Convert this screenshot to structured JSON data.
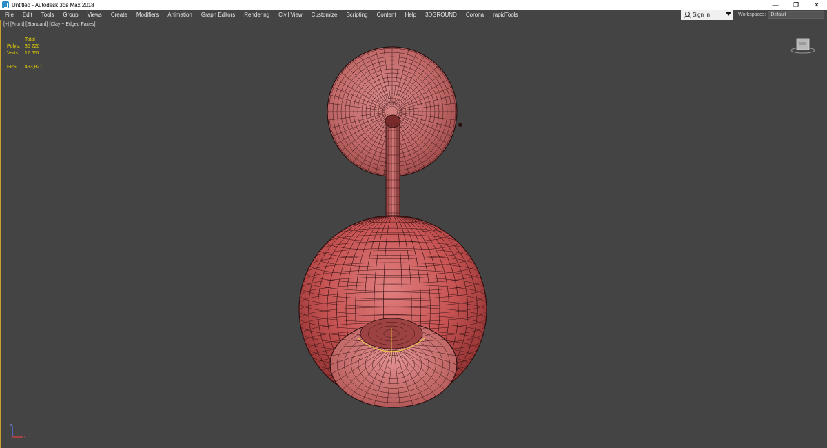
{
  "titlebar": {
    "title": "Untitled - Autodesk 3ds Max 2018",
    "minimize": "—",
    "restore": "❐",
    "close": "✕"
  },
  "menubar": {
    "items": [
      "File",
      "Edit",
      "Tools",
      "Group",
      "Views",
      "Create",
      "Modifiers",
      "Animation",
      "Graph Editors",
      "Rendering",
      "Civil View",
      "Customize",
      "Scripting",
      "Content",
      "Help",
      "3DGROUND",
      "Corona",
      "rapidTools"
    ],
    "sign_in": "Sign In",
    "workspaces_label": "Workspaces:",
    "workspaces_value": "Default"
  },
  "viewport": {
    "label_plus": "[+]",
    "label_view": "[Front]",
    "label_shading": "[Standard]",
    "label_style": "[Clay + Edged Faces]",
    "stats": {
      "total_label": "Total",
      "polys_label": "Polys:",
      "polys_value": "35 220",
      "verts_label": "Verts:",
      "verts_value": "17 657",
      "fps_label": "FPS:",
      "fps_value": "493,827"
    }
  },
  "colors": {
    "viewport_bg": "#444444",
    "mesh_fill": "#c05050",
    "wire": "#2a0f0f",
    "stats_text": "#e6d200",
    "active_border": "#c8a02a"
  },
  "icons": {
    "app": "3dsmax-app-icon",
    "user": "user-icon",
    "viewcube": "viewcube-icon",
    "axis": "axis-tripod-icon"
  }
}
